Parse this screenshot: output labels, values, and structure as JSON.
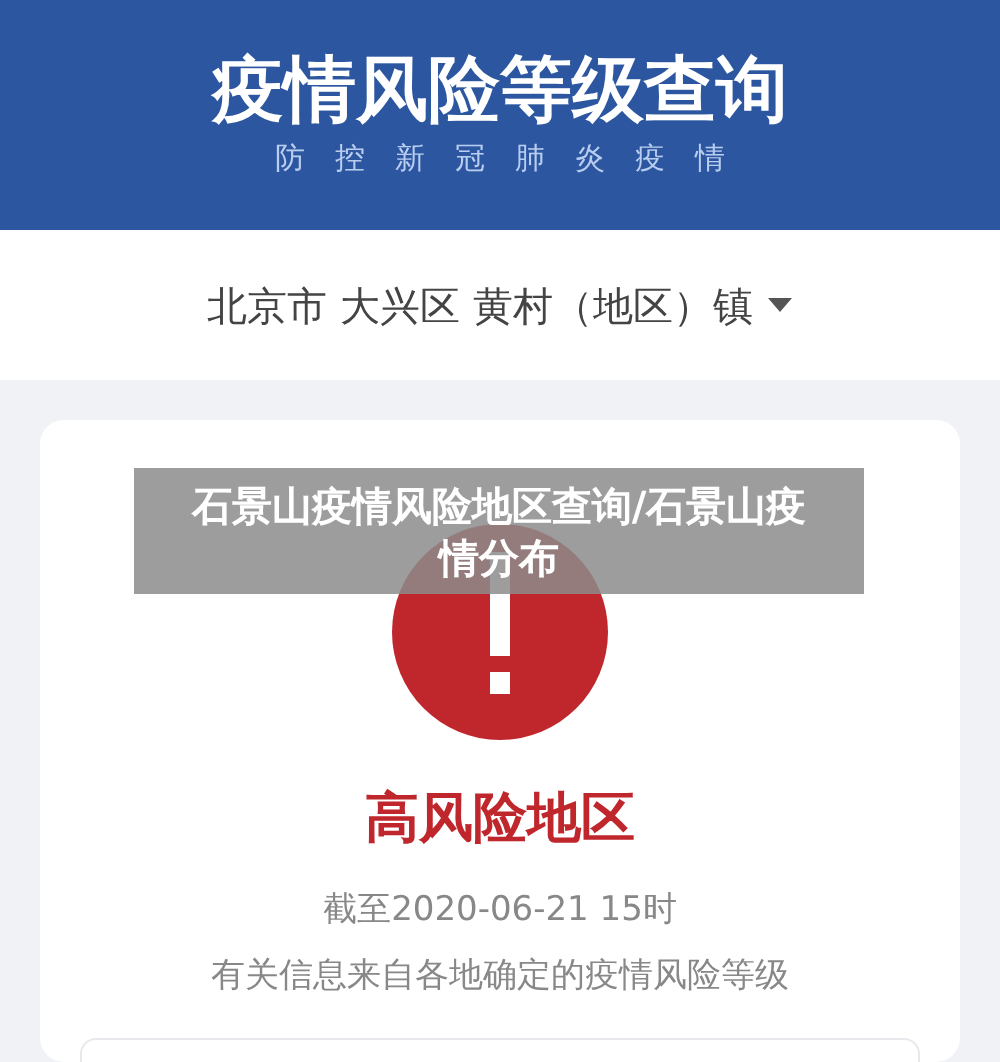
{
  "header": {
    "title": "疫情风险等级查询",
    "subtitle": "防控新冠肺炎疫情"
  },
  "location": {
    "text": "北京市 大兴区 黄村（地区）镇"
  },
  "result": {
    "kind": "high",
    "label": "高风险地区",
    "as_of": "截至2020-06-21 15时",
    "note": "有关信息来自各地确定的疫情风险等级"
  },
  "caption": "石景山疫情风险地区查询/石景山疫情分布"
}
